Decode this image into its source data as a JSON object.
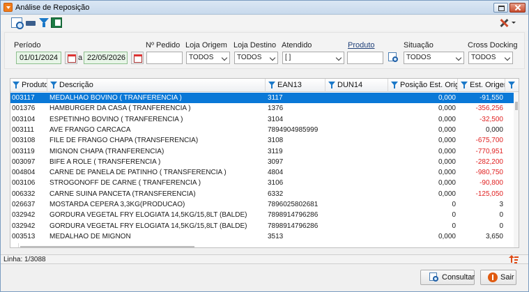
{
  "window": {
    "title": "Análise de Reposição"
  },
  "filters": {
    "periodo": {
      "label": "Período",
      "start": "01/01/2024",
      "separator": "a",
      "end": "22/05/2026"
    },
    "pedido": {
      "label": "Nº Pedido",
      "value": ""
    },
    "loja_origem": {
      "label": "Loja Origem",
      "value": "TODOS"
    },
    "loja_destino": {
      "label": "Loja Destino",
      "value": "TODOS"
    },
    "atendido": {
      "label": "Atendido",
      "value": "[ ]"
    },
    "produto": {
      "label": "Produto",
      "value": ""
    },
    "situacao": {
      "label": "Situação",
      "value": "TODOS"
    },
    "cross_docking": {
      "label": "Cross Docking",
      "value": "TODOS"
    }
  },
  "table": {
    "columns": [
      "Produto",
      "Descrição",
      "EAN13",
      "DUN14",
      "Posição Est. Origem",
      "Est. Origem"
    ],
    "rows": [
      [
        "003117",
        "MEDALHAO BOVINO  ( TRANFERENCIA )",
        "3117",
        "",
        "0,000",
        "-91,550"
      ],
      [
        "001376",
        "HAMBURGER DA CASA ( TRANFERENCIA )",
        "1376",
        "",
        "0,000",
        "-356,256"
      ],
      [
        "003104",
        "ESPETINHO BOVINO ( TRANFERENCIA )",
        "3104",
        "",
        "0,000",
        "-32,500"
      ],
      [
        "003111",
        "AVE FRANGO CARCACA",
        "7894904985999",
        "",
        "0,000",
        "0,000"
      ],
      [
        "003108",
        "FILE DE FRANGO CHAPA (TRANSFERENCIA)",
        "3108",
        "",
        "0,000",
        "-675,700"
      ],
      [
        "003119",
        "MIGNON CHAPA (TRANFERENCIA)",
        "3119",
        "",
        "0,000",
        "-770,951"
      ],
      [
        "003097",
        "BIFE A ROLE  ( TRANSFERENCIA )",
        "3097",
        "",
        "0,000",
        "-282,200"
      ],
      [
        "004804",
        "CARNE DE PANELA DE PATINHO ( TRANSFERENCIA )",
        "4804",
        "",
        "0,000",
        "-980,750"
      ],
      [
        "003106",
        "STROGONOFF DE CARNE  ( TRANFERENCIA )",
        "3106",
        "",
        "0,000",
        "-90,800"
      ],
      [
        "006332",
        "CARNE SUINA PANCETA  (TRANSFERENCIA)",
        "6332",
        "",
        "0,000",
        "-125,050"
      ],
      [
        "026637",
        "MOSTARDA CEPERA 3,3KG(PRODUCAO)",
        "7896025802681",
        "",
        "0",
        "3"
      ],
      [
        "032942",
        "GORDURA VEGETAL FRY ELOGIATA 14,5KG/15,8LT (BALDE)",
        "7898914796286",
        "",
        "0",
        "0"
      ],
      [
        "032942",
        "GORDURA VEGETAL FRY ELOGIATA 14,5KG/15,8LT (BALDE)",
        "7898914796286",
        "",
        "0",
        "0"
      ],
      [
        "003513",
        "MEDALHAO DE MIGNON",
        "3513",
        "",
        "0,000",
        "3,650"
      ]
    ],
    "selected_row": 0
  },
  "status": {
    "text": "Linha: 1/3088"
  },
  "buttons": {
    "consultar": "Consultar",
    "sair": "Sair"
  },
  "colors": {
    "selection": "#0a78d7",
    "negative": "#e02020",
    "accent": "#1a78c8"
  }
}
